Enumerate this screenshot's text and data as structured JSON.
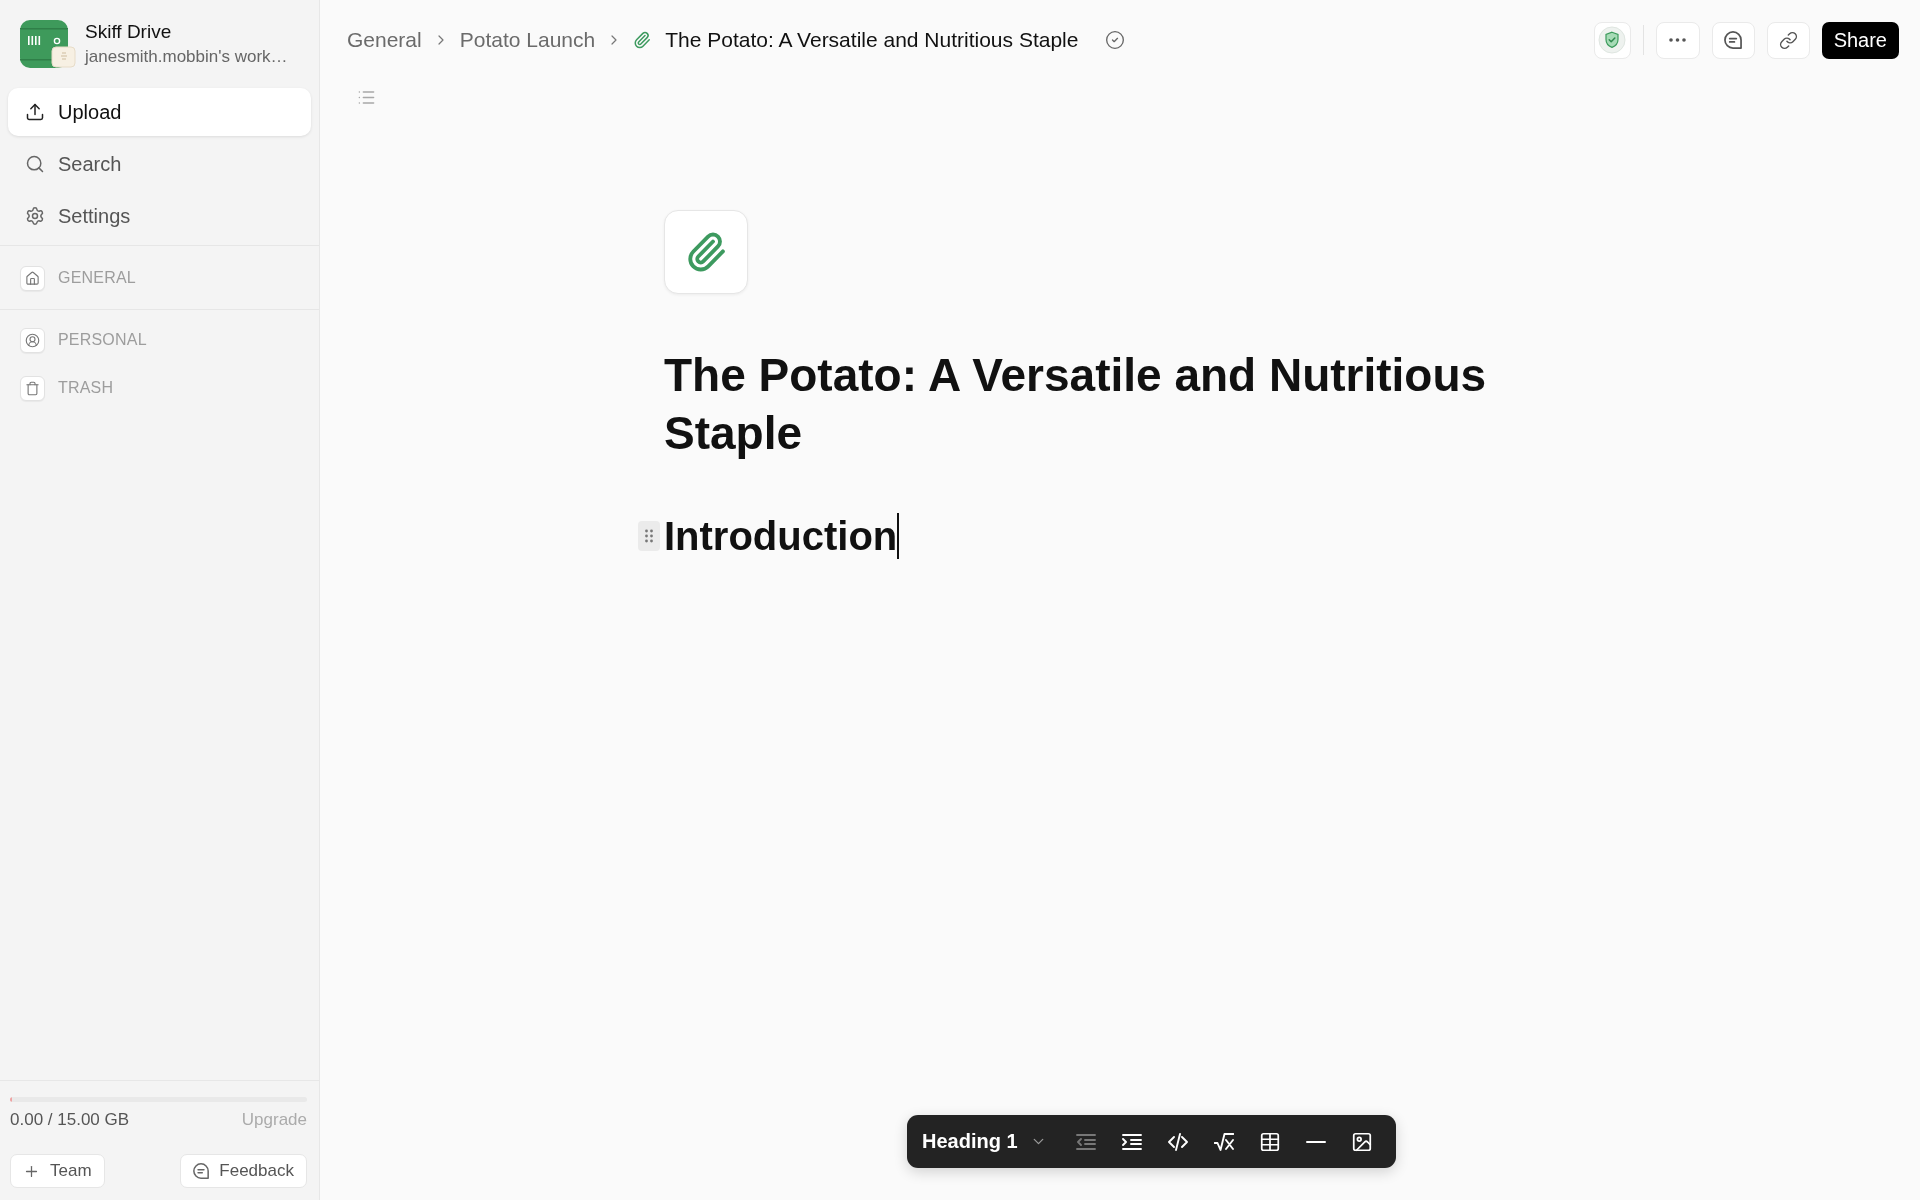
{
  "sidebar": {
    "app": {
      "name": "Skiff Drive",
      "workspace": "janesmith.mobbin's work…"
    },
    "actions": [
      {
        "label": "Upload",
        "kind": "primary"
      },
      {
        "label": "Search",
        "kind": "plain"
      },
      {
        "label": "Settings",
        "kind": "plain"
      }
    ],
    "sections": [
      {
        "label": "GENERAL"
      },
      {
        "label": "PERSONAL"
      },
      {
        "label": "TRASH"
      }
    ],
    "storage": {
      "usage": "0.00 / 15.00 GB",
      "level": 0.007,
      "upgrade": "Upgrade"
    },
    "footer_buttons": [
      "Team",
      "Feedback"
    ]
  },
  "header": {
    "breadcrumbs": [
      "General",
      "Potato Launch"
    ],
    "current": "The Potato: A Versatile and Nutritious Staple",
    "share": "Share"
  },
  "document": {
    "title": "The Potato: A Versatile and Nutritious Staple",
    "blocks": [
      {
        "kind": "heading",
        "text": "Introduction",
        "focused": true
      }
    ]
  },
  "toolbar": {
    "block_type": "Heading 1",
    "tools": [
      {
        "disabled": true
      },
      {
        "disabled": false
      },
      {
        "disabled": false
      },
      {
        "disabled": false
      },
      {
        "disabled": false
      },
      {
        "disabled": false
      },
      {
        "disabled": false
      }
    ]
  }
}
